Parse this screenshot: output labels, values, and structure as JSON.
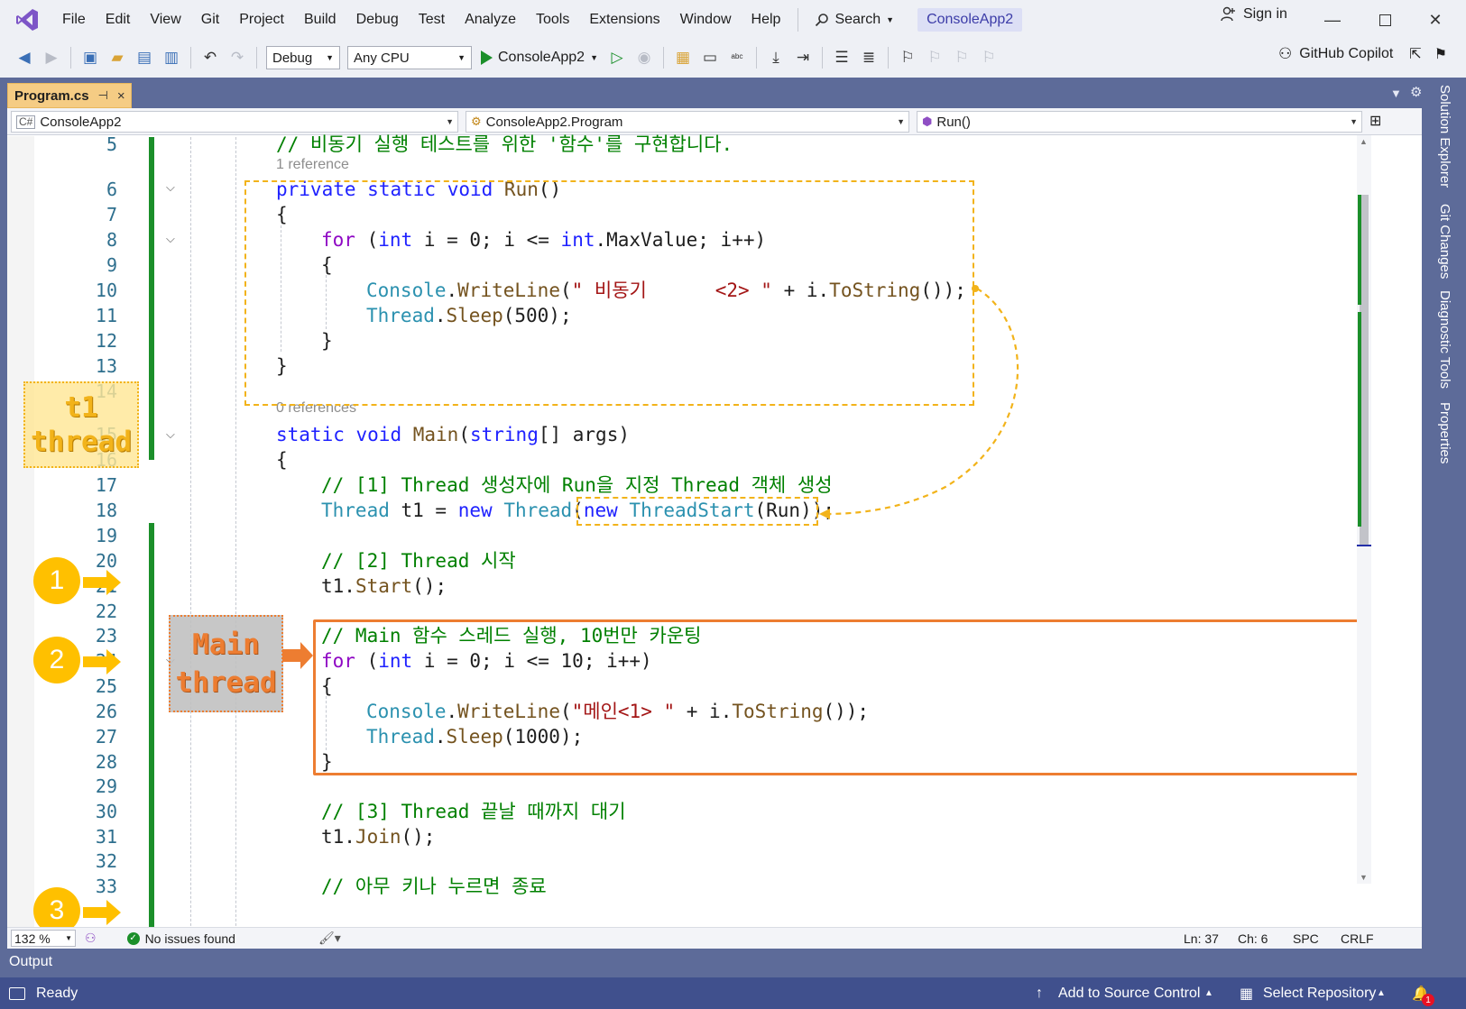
{
  "menu": {
    "items": [
      "File",
      "Edit",
      "View",
      "Git",
      "Project",
      "Build",
      "Debug",
      "Test",
      "Analyze",
      "Tools",
      "Extensions",
      "Window",
      "Help"
    ],
    "search_label": "Search",
    "project_name": "ConsoleApp2",
    "sign_in": "Sign in"
  },
  "toolbar": {
    "configuration": "Debug",
    "platform": "Any CPU",
    "start_target": "ConsoleApp2",
    "copilot": "GitHub Copilot"
  },
  "document": {
    "tab_title": "Program.cs",
    "tab_pin": "⊣",
    "tab_close": "×"
  },
  "navbar": {
    "project": "ConsoleApp2",
    "type": "ConsoleApp2.Program",
    "member": "Run()"
  },
  "editor": {
    "ref_hints": [
      "1 reference",
      "0 references"
    ],
    "lines": [
      {
        "n": "5"
      },
      {
        "n": "6"
      },
      {
        "n": "7"
      },
      {
        "n": "8"
      },
      {
        "n": "9"
      },
      {
        "n": "10"
      },
      {
        "n": "11"
      },
      {
        "n": "12"
      },
      {
        "n": "13"
      },
      {
        "n": "14"
      },
      {
        "n": "15"
      },
      {
        "n": "16"
      },
      {
        "n": "17"
      },
      {
        "n": "18"
      },
      {
        "n": "19"
      },
      {
        "n": "20"
      },
      {
        "n": "21"
      },
      {
        "n": "22"
      },
      {
        "n": "23"
      },
      {
        "n": "24"
      },
      {
        "n": "25"
      },
      {
        "n": "26"
      },
      {
        "n": "27"
      },
      {
        "n": "28"
      },
      {
        "n": "29"
      },
      {
        "n": "30"
      },
      {
        "n": "31"
      },
      {
        "n": "32"
      },
      {
        "n": "33"
      }
    ],
    "code": {
      "l5_comment": "// 비동기 실행 테스트를 위한 '함수'를 구현합니다.",
      "l6_private": "private",
      "l6_static": "static",
      "l6_void": "void",
      "l6_name": "Run",
      "l6_parens": "()",
      "open_brace": "{",
      "close_brace": "}",
      "l8_for": "for",
      "l8_a": " (",
      "l8_int": "int",
      "l8_b": " i = 0; i <= ",
      "l8_int2": "int",
      "l8_c": ".MaxValue; i++)",
      "l10_console": "Console",
      "l10_dot": ".",
      "l10_writeline": "WriteLine",
      "l10_open": "(",
      "l10_str": "\" 비동기      <2> \"",
      "l10_rest": " + i.",
      "l10_tostring": "ToString",
      "l10_end": "());",
      "l11_thread": "Thread",
      "l11_sleep": "Sleep",
      "l11_args": "(500);",
      "l15_static": "static",
      "l15_void": "void",
      "l15_main": "Main",
      "l15_open": "(",
      "l15_string": "string",
      "l15_rest": "[] args)",
      "l17_comment": "// [1] Thread 생성자에 Run을 지정 Thread 객체 생성",
      "l18_thread": "Thread",
      "l18_t1": " t1 = ",
      "l18_new": "new",
      "l18_thread2": "Thread",
      "l18_open": "(",
      "l18_new2": "new",
      "l18_threadstart": "ThreadStart",
      "l18_run": "(Run));",
      "l20_comment": "// [2] Thread 시작",
      "l21_t1": "t1.",
      "l21_start": "Start",
      "l21_end": "();",
      "l23_comment": "// Main 함수 스레드 실행, 10번만 카운팅",
      "l24_for": "for",
      "l24_a": " (",
      "l24_int": "int",
      "l24_b": " i = 0; i <= 10; i++)",
      "l26_str": "\"메인<1> \"",
      "l27_args": "(1000);",
      "l30_comment": "// [3] Thread 끝날 때까지 대기",
      "l31_t1": "t1.",
      "l31_join": "Join",
      "l31_end": "();",
      "l33_comment": "// 아무 키나 누르면 종료"
    }
  },
  "annotations": {
    "t1_label": [
      "t1",
      "thread"
    ],
    "main_label": [
      "Main",
      "thread"
    ],
    "steps": [
      "1",
      "2",
      "3"
    ],
    "colors": {
      "dashed": "#f2b31a",
      "main": "#ed7d31",
      "step": "#ffc000"
    }
  },
  "edit_status": {
    "zoom": "132 %",
    "issues": "No issues found",
    "ln": "Ln: 37",
    "ch": "Ch: 6",
    "spc": "SPC",
    "crlf": "CRLF"
  },
  "side_tabs": [
    "Solution Explorer",
    "Git Changes",
    "Diagnostic Tools",
    "Properties"
  ],
  "output_label": "Output",
  "statusbar": {
    "ready": "Ready",
    "add_source": "Add to Source Control",
    "select_repo": "Select Repository",
    "notif_count": "1"
  }
}
